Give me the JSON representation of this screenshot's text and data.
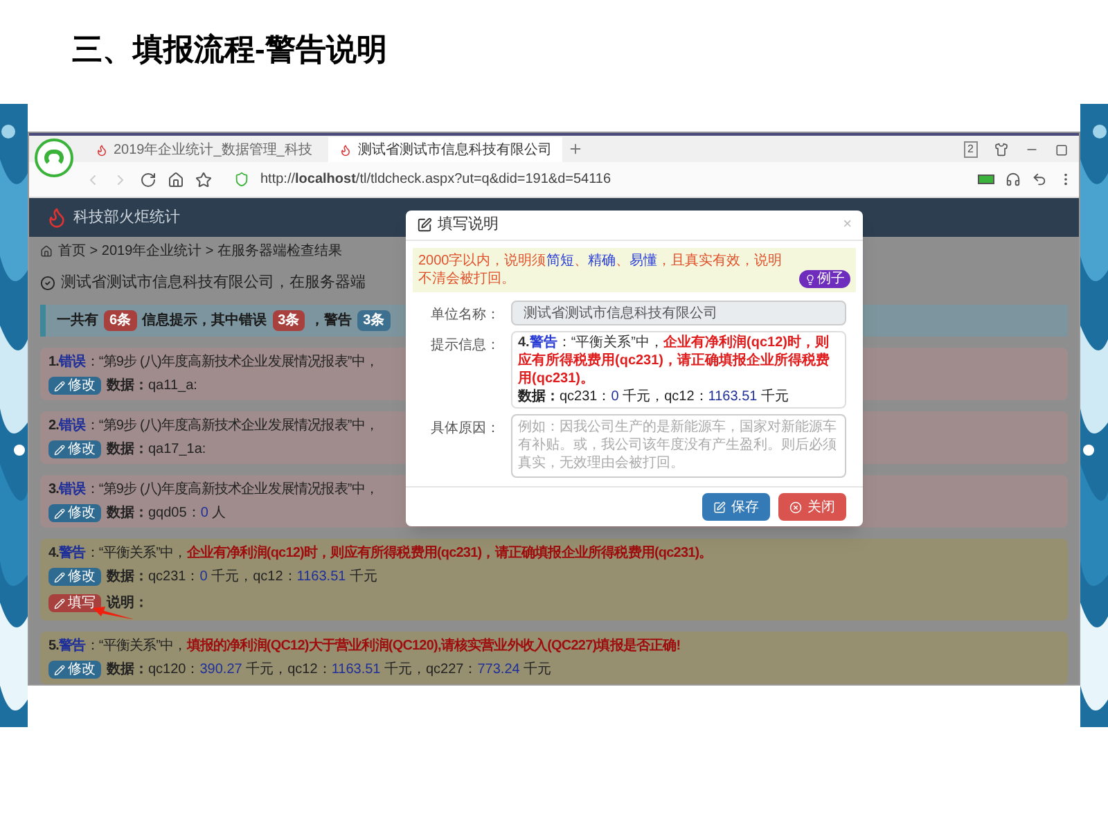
{
  "slide": {
    "title": "三、填报流程-警告说明"
  },
  "browser": {
    "tabs": [
      {
        "label": "2019年企业统计_数据管理_科技",
        "selected": false
      },
      {
        "label": "测试省测试市信息科技有限公司",
        "selected": true
      }
    ],
    "tab_count": "2",
    "url_prefix": "http://",
    "url_host": "localhost",
    "url_path": "/tl/tldcheck.aspx?ut=q&did=191&d=54116"
  },
  "app": {
    "name": "科技部火炬统计",
    "breadcrumb": "首页 > 2019年企业统计 > 在服务器端检查结果",
    "heading": "测试省测试市信息科技有限公司，在服务器端",
    "summary": [
      {
        "kind": "text",
        "text": "一共有"
      },
      {
        "kind": "badge",
        "text": "6条",
        "color": "#a8403d"
      },
      {
        "kind": "text",
        "text": "信息提示，其中错误"
      },
      {
        "kind": "badge",
        "text": "3条",
        "color": "#a8403d"
      },
      {
        "kind": "text",
        "text": "，警告"
      },
      {
        "kind": "badge",
        "text": "3条",
        "color": "#3d6f8f"
      }
    ],
    "items": [
      {
        "kind": "error",
        "number": "1.",
        "label": "错误",
        "intro": "：“第9步 (八)年度高新技术企业发展情况报表”中，",
        "edit_button": "修改",
        "data_label": "数据：",
        "data": [
          {
            "name": "qa11_a:"
          }
        ]
      },
      {
        "kind": "error",
        "number": "2.",
        "label": "错误",
        "intro": "：“第9步 (八)年度高新技术企业发展情况报表”中，",
        "edit_button": "修改",
        "data_label": "数据：",
        "data": [
          {
            "name": "qa17_1a:"
          }
        ]
      },
      {
        "kind": "error",
        "number": "3.",
        "label": "错误",
        "intro": "：“第9步 (八)年度高新技术企业发展情况报表”中，",
        "edit_button": "修改",
        "data_label": "数据：",
        "data": [
          {
            "name": "gqd05：",
            "value": "0",
            "unit": " 人"
          }
        ]
      },
      {
        "kind": "warning",
        "number": "4.",
        "label": "警告",
        "intro": "：“平衡关系”中，",
        "message": "企业有净利润(qc12)时，则应有所得税费用(qc231)，请正确填报企业所得税费用(qc231)。",
        "edit_button": "修改",
        "data_label": "数据：",
        "data": [
          {
            "name": "qc231：",
            "value": "0",
            "unit": " 千元，"
          },
          {
            "name": "qc12：",
            "value": "1163.51",
            "unit": " 千元"
          }
        ],
        "note_button": "填写",
        "note_label": "说明："
      },
      {
        "kind": "warning",
        "number": "5.",
        "label": "警告",
        "intro": "：“平衡关系”中，",
        "message": "填报的净利润(QC12)大于营业利润(QC120),请核实营业外收入(QC227)填报是否正确!",
        "edit_button": "修改",
        "data_label": "数据：",
        "data": [
          {
            "name": "qc120：",
            "value": "390.27",
            "unit": " 千元，"
          },
          {
            "name": "qc12：",
            "value": "1163.51",
            "unit": " 千元，"
          },
          {
            "name": "qc227：",
            "value": "773.24",
            "unit": " 千元"
          }
        ]
      }
    ]
  },
  "dialog": {
    "title": "填写说明",
    "close": "×",
    "notice": [
      {
        "kind": "plain",
        "text": "2000字以内，说明须"
      },
      {
        "kind": "emphasis",
        "text": "简短"
      },
      {
        "kind": "plain",
        "text": "、"
      },
      {
        "kind": "emphasis",
        "text": "精确"
      },
      {
        "kind": "plain",
        "text": "、"
      },
      {
        "kind": "emphasis",
        "text": "易懂"
      },
      {
        "kind": "plain",
        "text": "，且真实有效，说明不清会被打回。"
      }
    ],
    "example_badge": "例子",
    "unit_label": "单位名称：",
    "unit_value": "测试省测试市信息科技有限公司",
    "hint_label": "提示信息：",
    "hint": {
      "number": "4.",
      "label": "警告",
      "intro": "：“平衡关系”中，",
      "message": "企业有净利润(qc12)时，则应有所得税费用(qc231)，请正确填报企业所得税费用(qc231)。",
      "data_label": "数据：",
      "data": [
        {
          "name": "qc231：",
          "value": "0",
          "unit": " 千元，"
        },
        {
          "name": "qc12：",
          "value": "1163.51",
          "unit": " 千元"
        }
      ]
    },
    "reason_label": "具体原因：",
    "reason_placeholder": "例如：因我公司生产的是新能源车，国家对新能源车有补贴。或，我公司该年度没有产生盈利。则后必须真实，无效理由会被打回。",
    "buttons": [
      {
        "kind": "save",
        "label": "保存"
      },
      {
        "kind": "close",
        "label": "关闭"
      }
    ]
  }
}
